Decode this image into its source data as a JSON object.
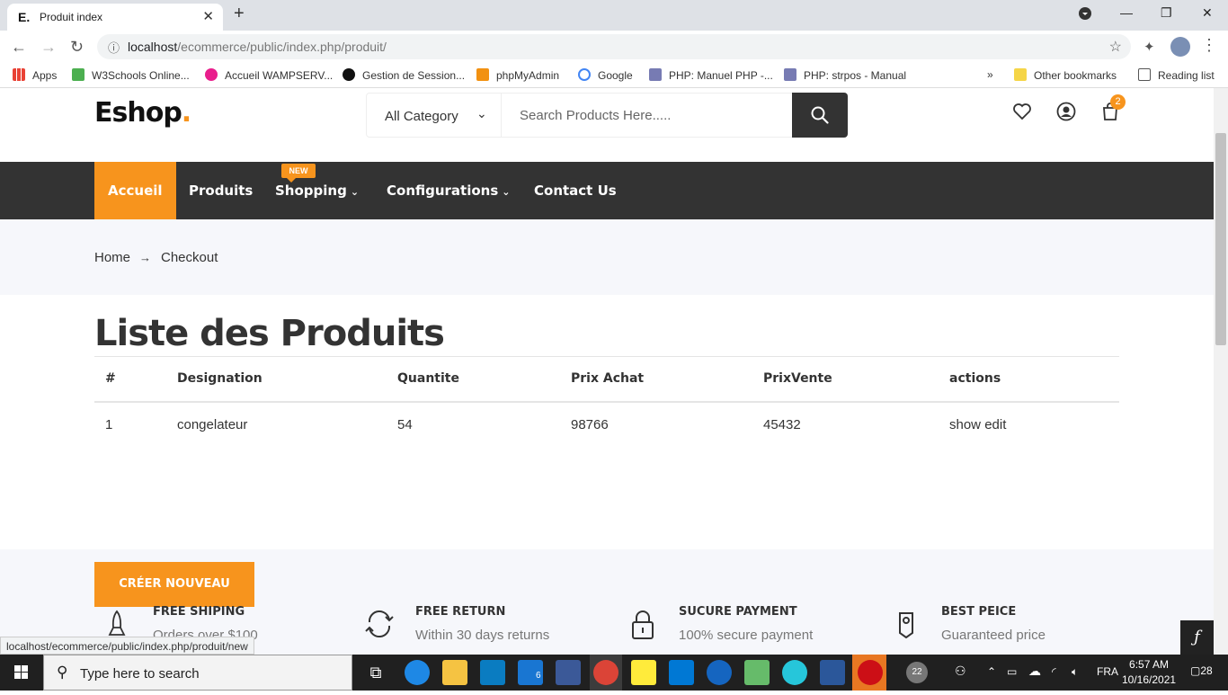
{
  "browser": {
    "tab_title": "Produit index",
    "tab_favicon": "E.",
    "url_host": "localhost",
    "url_path": "/ecommerce/public/index.php/produit/",
    "bookmarks": [
      "Apps",
      "W3Schools Online...",
      "Accueil WAMPSERV...",
      "Gestion de Session...",
      "phpMyAdmin",
      "Google",
      "PHP: Manuel PHP -...",
      "PHP: strpos - Manual"
    ],
    "overflow": "»",
    "other_bookmarks": "Other bookmarks",
    "reading_list": "Reading list"
  },
  "header": {
    "logo": "Eshop",
    "logo_dot": ".",
    "category_label": "All Category",
    "search_placeholder": "Search Products Here.....",
    "cart_count": "2"
  },
  "nav": {
    "items": [
      "Accueil",
      "Produits",
      "Shopping",
      "Configurations",
      "Contact Us"
    ],
    "new_badge": "NEW"
  },
  "breadcrumb": {
    "home": "Home",
    "current": "Checkout"
  },
  "main": {
    "heading": "Liste des Produits",
    "columns": [
      "#",
      "Designation",
      "Quantite",
      "Prix Achat",
      "PrixVente",
      "actions"
    ],
    "rows": [
      {
        "id": "1",
        "designation": "congelateur",
        "quantite": "54",
        "prix_achat": "98766",
        "prix_vente": "45432",
        "show": "show",
        "edit": "edit"
      }
    ],
    "create_button": "CRÉER NOUVEAU"
  },
  "features": [
    {
      "title": "FREE SHIPING",
      "desc": "Orders over $100"
    },
    {
      "title": "FREE RETURN",
      "desc": "Within 30 days returns"
    },
    {
      "title": "SUCURE PAYMENT",
      "desc": "100% secure payment"
    },
    {
      "title": "BEST PEICE",
      "desc": "Guaranteed price"
    }
  ],
  "status_url": "localhost/ecommerce/public/index.php/produit/new",
  "taskbar": {
    "search_placeholder": "Type here to search",
    "mail_badge": "6",
    "weather": "22",
    "lang": "FRA",
    "time": "6:57 AM",
    "date": "10/16/2021",
    "notif_count": "28"
  },
  "colors": {
    "accent": "#f7941d",
    "nav_bg": "#333333",
    "light_bg": "#f6f7fb"
  }
}
